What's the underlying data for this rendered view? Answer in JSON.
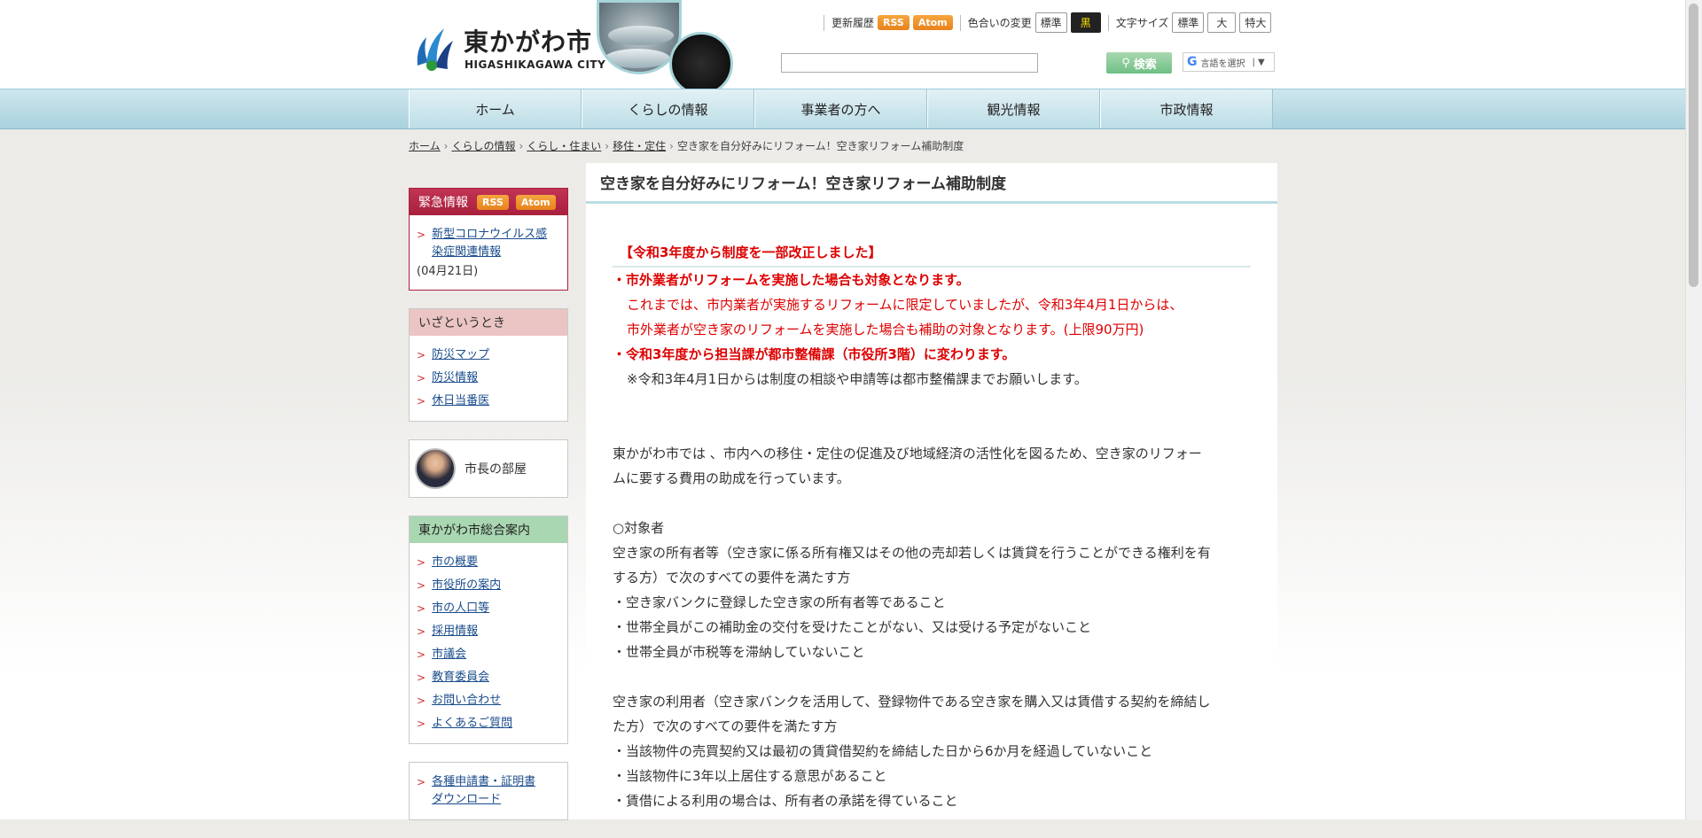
{
  "header": {
    "site_name": "東かがわ市",
    "site_sub": "HIGASHIKAGAWA CITY",
    "update_label": "更新履歴",
    "rss": "RSS",
    "atom": "Atom",
    "color_label": "色合いの変更",
    "color_standard": "標準",
    "color_black": "黒",
    "font_label": "文字サイズ",
    "font_standard": "標準",
    "font_large": "大",
    "font_xlarge": "特大",
    "search_button": "検索",
    "lang_label": "言語を選択"
  },
  "nav": [
    "ホーム",
    "くらしの情報",
    "事業者の方へ",
    "観光情報",
    "市政情報"
  ],
  "breadcrumb": {
    "items": [
      "ホーム",
      "くらしの情報",
      "くらし・住まい",
      "移住・定住"
    ],
    "current": "空き家を自分好みにリフォーム！空き家リフォーム補助制度"
  },
  "sidebar": {
    "emergency": {
      "title": "緊急情報",
      "rss": "RSS",
      "atom": "Atom",
      "link1": "新型コロナウイルス感",
      "link2": "染症関連情報",
      "date": "(04月21日)"
    },
    "disaster": {
      "title": "いざというとき",
      "items": [
        "防災マップ",
        "防災情報",
        "休日当番医"
      ]
    },
    "mayor": "市長の部屋",
    "guide": {
      "title": "東かがわ市総合案内",
      "items": [
        "市の概要",
        "市役所の案内",
        "市の人口等",
        "採用情報",
        "市議会",
        "教育委員会",
        "お問い合わせ",
        "よくあるご質問"
      ]
    },
    "download1": "各種申請書・証明書",
    "download2": "ダウンロード"
  },
  "main": {
    "title": "空き家を自分好みにリフォーム！空き家リフォーム補助制度",
    "notice_title": "【令和3年度から制度を一部改正しました】",
    "n1": "・市外業者がリフォームを実施した場合も対象となります。",
    "n2": "これまでは、市内業者が実施するリフォームに限定していましたが、令和3年4月1日からは、",
    "n3": "市外業者が空き家のリフォームを実施した場合も補助の対象となります。(上限90万円)",
    "n4": "・令和3年度から担当課が都市整備課（市役所3階）に変わります。",
    "n5": "※令和3年4月1日からは制度の相談や申請等は都市整備課までお願いします。",
    "p1a": "東かがわ市では 、市内への移住・定住の促進及び地域経済の活性化を図るため、空き家のリフォー",
    "p1b": "ムに要する費用の助成を行っています。",
    "target": "○対象者",
    "o1a": "空き家の所有者等（空き家に係る所有権又はその他の売却若しくは賃貸を行うことができる権利を有",
    "o1b": "する方）で次のすべての要件を満たす方",
    "o2": "・空き家バンクに登録した空き家の所有者等であること",
    "o3": "・世帯全員がこの補助金の交付を受けたことがない、又は受ける予定がないこと",
    "o4": "・世帯全員が市税等を滞納していないこと",
    "u1a": "空き家の利用者（空き家バンクを活用して、登録物件である空き家を購入又は賃借する契約を締結し",
    "u1b": "た方）で次のすべての要件を満たす方",
    "u2": "・当該物件の売買契約又は最初の賃貸借契約を締結した日から6か月を経過していないこと",
    "u3": "・当該物件に3年以上居住する意思があること",
    "u4": "・賃借による利用の場合は、所有者の承諾を得ていること"
  }
}
